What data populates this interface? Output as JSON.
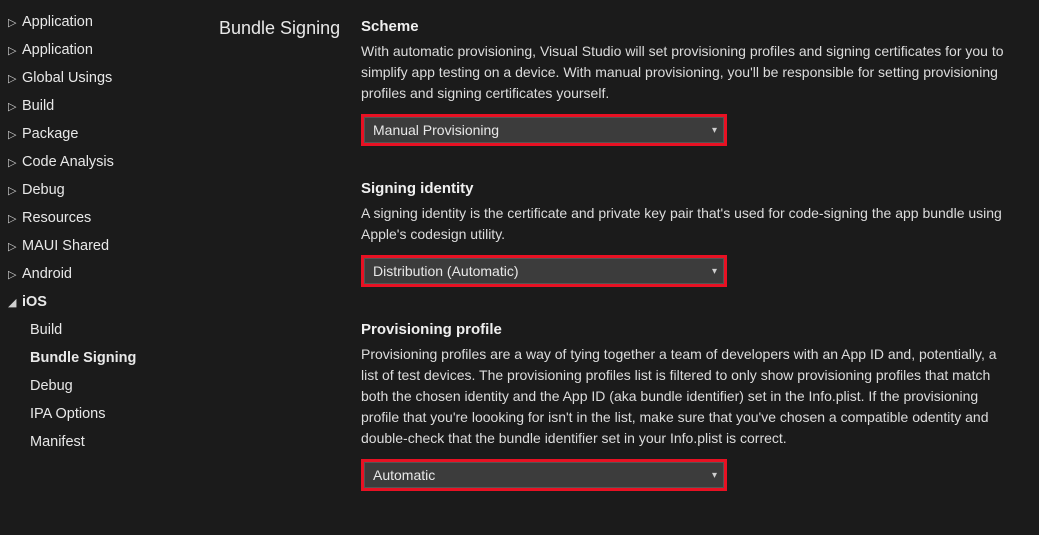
{
  "sidebar": {
    "items": [
      {
        "label": "Application",
        "expanded": false,
        "level": 0
      },
      {
        "label": "Application",
        "expanded": false,
        "level": 0
      },
      {
        "label": "Global Usings",
        "expanded": false,
        "level": 0
      },
      {
        "label": "Build",
        "expanded": false,
        "level": 0
      },
      {
        "label": "Package",
        "expanded": false,
        "level": 0
      },
      {
        "label": "Code Analysis",
        "expanded": false,
        "level": 0
      },
      {
        "label": "Debug",
        "expanded": false,
        "level": 0
      },
      {
        "label": "Resources",
        "expanded": false,
        "level": 0
      },
      {
        "label": "MAUI Shared",
        "expanded": false,
        "level": 0
      },
      {
        "label": "Android",
        "expanded": false,
        "level": 0
      },
      {
        "label": "iOS",
        "expanded": true,
        "level": 0
      },
      {
        "label": "Build",
        "level": 1
      },
      {
        "label": "Bundle Signing",
        "level": 1,
        "selected": true
      },
      {
        "label": "Debug",
        "level": 1
      },
      {
        "label": "IPA Options",
        "level": 1
      },
      {
        "label": "Manifest",
        "level": 1
      }
    ]
  },
  "section_title": "Bundle Signing",
  "fields": {
    "scheme": {
      "title": "Scheme",
      "desc": "With automatic provisioning, Visual Studio will set provisioning profiles and signing certificates for you to simplify app testing on a device. With manual provisioning, you'll be responsible for setting provisioning profiles and signing certificates yourself.",
      "value": "Manual Provisioning"
    },
    "identity": {
      "title": "Signing identity",
      "desc": "A signing identity is the certificate and private key pair that's used for code-signing the app bundle using Apple's codesign utility.",
      "value": "Distribution (Automatic)"
    },
    "profile": {
      "title": "Provisioning profile",
      "desc": "Provisioning profiles are a way of tying together a team of developers with an App ID and, potentially, a list of test devices. The provisioning profiles list is filtered to only show provisioning profiles that match both the chosen identity and the App ID (aka bundle identifier) set in the Info.plist. If the provisioning profile that you're loooking for isn't in the list, make sure that you've chosen a compatible odentity and double-check that the bundle identifier set in your Info.plist is correct.",
      "value": "Automatic"
    }
  },
  "glyphs": {
    "collapsed": "▷",
    "expanded": "◢",
    "caret": "▾"
  }
}
